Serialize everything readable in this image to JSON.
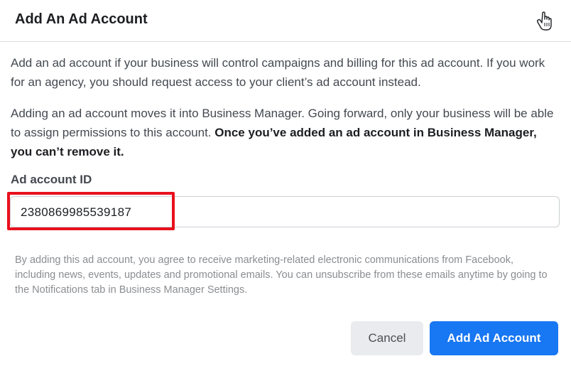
{
  "dialog": {
    "title": "Add An Ad Account",
    "close_icon": "hand-cursor-icon",
    "paragraph1": "Add an ad account if your business will control campaigns and billing for this ad account. If you work for an agency, you should request access to your client’s ad account instead.",
    "paragraph2_normal": "Adding an ad account moves it into Business Manager. Going forward, only your business will be able to assign permissions to this account. ",
    "paragraph2_bold": "Once you’ve added an ad account in Business Manager, you can’t remove it.",
    "field_label": "Ad account ID",
    "field_value": "2380869985539187",
    "disclaimer": "By adding this ad account, you agree to receive marketing-related electronic communications from Facebook, including news, events, updates and promotional emails. You can unsubscribe from these emails anytime by going to the Notifications tab in Business Manager Settings.",
    "cancel_label": "Cancel",
    "submit_label": "Add Ad Account"
  },
  "colors": {
    "primary": "#1877f2",
    "highlight": "#e8101d",
    "cancel_bg": "#e9ebee"
  }
}
